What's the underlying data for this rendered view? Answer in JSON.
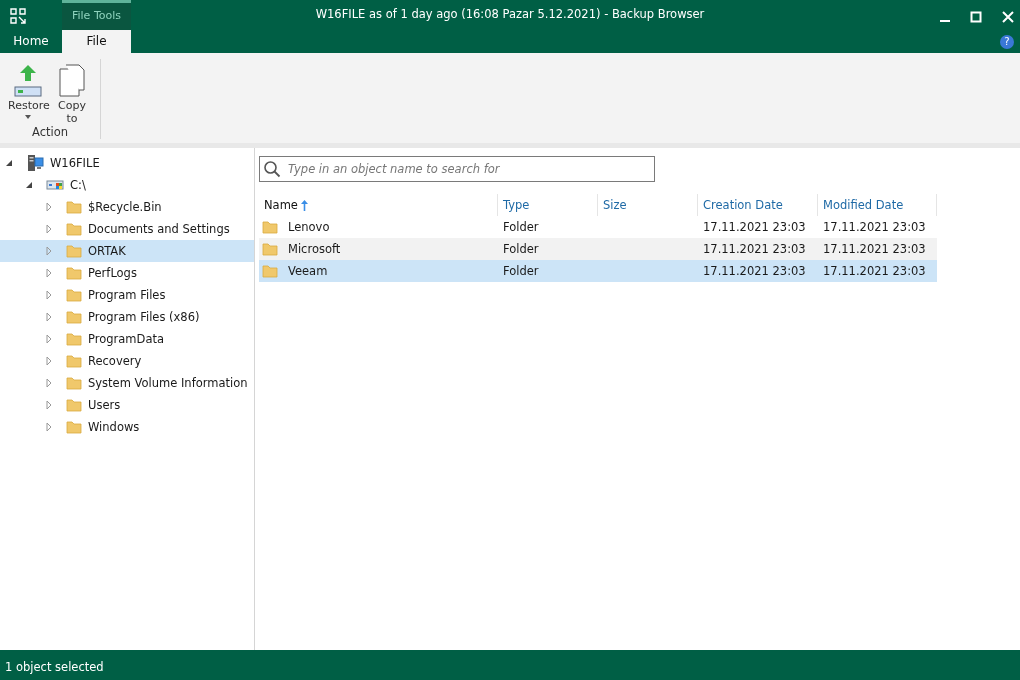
{
  "window": {
    "title": "W16FILE as of 1 day ago (16:08 Pazar 5.12.2021) - Backup Browser"
  },
  "ribbon": {
    "context_label": "File Tools",
    "tabs": [
      {
        "label": "Home",
        "selected": false
      },
      {
        "label": "File",
        "selected": true
      }
    ],
    "help": {
      "label": "?"
    },
    "groups": [
      {
        "label": "Action",
        "buttons": [
          {
            "label": "Restore",
            "kind": "restore",
            "dropdown": true
          },
          {
            "label": "Copy to",
            "kind": "copy",
            "dropdown": false
          }
        ]
      }
    ]
  },
  "tree": [
    {
      "label": "W16FILE",
      "kind": "server",
      "expanded": true,
      "selected": false,
      "children": [
        {
          "label": "C:\\",
          "kind": "drive",
          "expanded": true,
          "selected": false,
          "children": [
            {
              "label": "$Recycle.Bin",
              "kind": "folder",
              "expanded": false,
              "selected": false
            },
            {
              "label": "Documents and Settings",
              "kind": "folder",
              "expanded": false,
              "selected": false
            },
            {
              "label": "ORTAK",
              "kind": "folder",
              "expanded": false,
              "selected": true
            },
            {
              "label": "PerfLogs",
              "kind": "folder",
              "expanded": false,
              "selected": false
            },
            {
              "label": "Program Files",
              "kind": "folder",
              "expanded": false,
              "selected": false
            },
            {
              "label": "Program Files (x86)",
              "kind": "folder",
              "expanded": false,
              "selected": false
            },
            {
              "label": "ProgramData",
              "kind": "folder",
              "expanded": false,
              "selected": false
            },
            {
              "label": "Recovery",
              "kind": "folder",
              "expanded": false,
              "selected": false
            },
            {
              "label": "System Volume Information",
              "kind": "folder",
              "expanded": false,
              "selected": false
            },
            {
              "label": "Users",
              "kind": "folder",
              "expanded": false,
              "selected": false
            },
            {
              "label": "Windows",
              "kind": "folder",
              "expanded": false,
              "selected": false
            }
          ]
        }
      ]
    }
  ],
  "search": {
    "placeholder": "Type in an object name to search for"
  },
  "table": {
    "columns": [
      {
        "label": "Name",
        "sorted": true
      },
      {
        "label": "Type",
        "sorted": false
      },
      {
        "label": "Size",
        "sorted": false
      },
      {
        "label": "Creation Date",
        "sorted": false
      },
      {
        "label": "Modified Date",
        "sorted": false
      }
    ],
    "rows": [
      {
        "name": "Lenovo",
        "type": "Folder",
        "created": "17.11.2021 23:03",
        "modified": "17.11.2021 23:03",
        "selected": false,
        "hovered": false
      },
      {
        "name": "Microsoft",
        "type": "Folder",
        "created": "17.11.2021 23:03",
        "modified": "17.11.2021 23:03",
        "selected": false,
        "hovered": true
      },
      {
        "name": "Veeam",
        "type": "Folder",
        "created": "17.11.2021 23:03",
        "modified": "17.11.2021 23:03",
        "selected": true,
        "hovered": false
      }
    ]
  },
  "status_bar": {
    "text": "1 object selected"
  }
}
